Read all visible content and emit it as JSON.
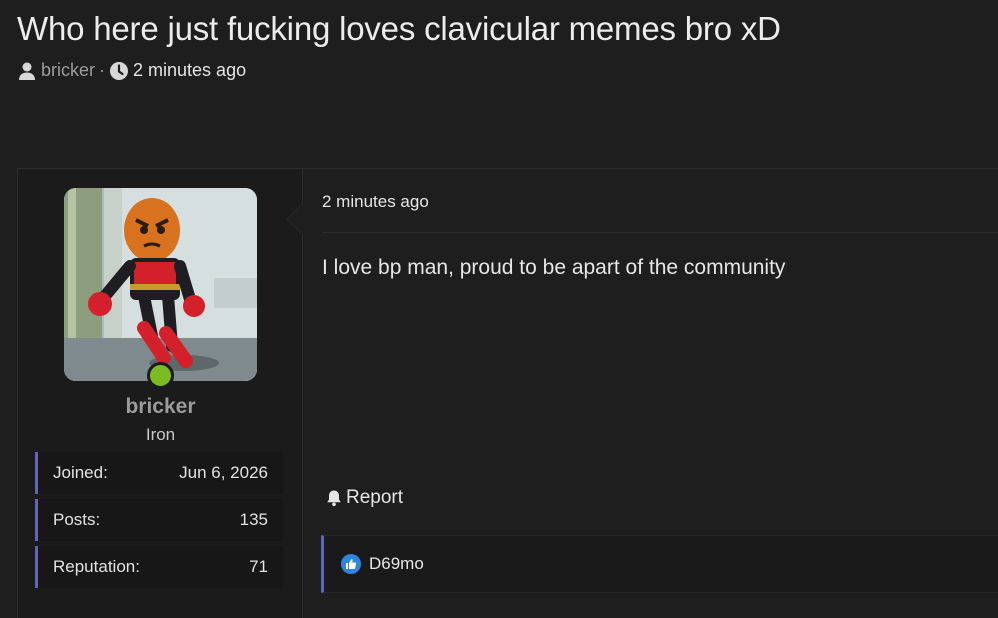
{
  "thread": {
    "title": "Who here just fucking loves clavicular memes bro xD",
    "author": "bricker",
    "separator": "·",
    "time": "2 minutes ago"
  },
  "user": {
    "name": "bricker",
    "rank": "Iron",
    "online": true,
    "stats": [
      {
        "label": "Joined:",
        "value": "Jun 6, 2026"
      },
      {
        "label": "Posts:",
        "value": "135"
      },
      {
        "label": "Reputation:",
        "value": "71"
      }
    ]
  },
  "post": {
    "date": "2 minutes ago",
    "body": "I love bp man, proud to be apart of the community",
    "report_label": "Report",
    "reaction_user": "D69mo"
  },
  "colors": {
    "background": "#1e1e1f",
    "accent": "#6066b8",
    "online": "#7cbb22",
    "like": "#2f86e0"
  }
}
